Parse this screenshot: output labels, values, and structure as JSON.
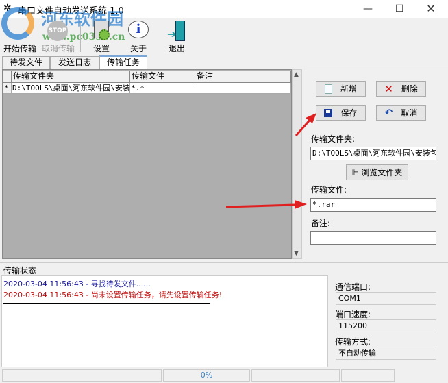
{
  "window": {
    "title": "串口文件自动发送系统 1.0",
    "controls": [
      "minimize",
      "maximize",
      "close"
    ]
  },
  "watermark": {
    "text": "河东软件园",
    "url": "www.pc0359.cn"
  },
  "toolbar": [
    {
      "label": "开始传输",
      "icon": "start-transfer-icon",
      "enabled": true
    },
    {
      "label": "取消传输",
      "icon": "stop-icon",
      "enabled": false
    },
    {
      "label": "设置",
      "icon": "settings-icon",
      "enabled": true
    },
    {
      "label": "关于",
      "icon": "info-icon",
      "enabled": true
    },
    {
      "label": "退出",
      "icon": "exit-door-icon",
      "enabled": true
    }
  ],
  "tabs": [
    {
      "label": "待发文件"
    },
    {
      "label": "发送日志"
    },
    {
      "label": "传输任务",
      "active": true
    }
  ],
  "grid": {
    "columns": [
      "传输文件夹",
      "传输文件",
      "备注"
    ],
    "rows": [
      {
        "indicator": "*",
        "folder": "D:\\TOOLS\\桌面\\河东软件园\\安装包",
        "file": "*.*",
        "note": ""
      }
    ]
  },
  "form": {
    "new_label": "新增",
    "delete_label": "删除",
    "save_label": "保存",
    "cancel_label": "取消",
    "folder_label": "传输文件夹:",
    "folder_value": "D:\\TOOLS\\桌面\\河东软件园\\安装包",
    "browse_label": "浏览文件夹",
    "file_label": "传输文件:",
    "file_value": "*.rar",
    "note_label": "备注:",
    "note_value": ""
  },
  "status": {
    "header": "传输状态",
    "log": [
      {
        "text": "2020-03-04 11:56:43 - 寻找待发文件......",
        "color": "#1a1aa0"
      },
      {
        "text": "2020-03-04 11:56:43 - 尚未设置传输任务，请先设置传输任务!",
        "color": "#c01010"
      }
    ],
    "port_label": "通信端口:",
    "port_value": "COM1",
    "speed_label": "端口速度:",
    "speed_value": "115200",
    "mode_label": "传输方式:",
    "mode_value": "不自动传输"
  },
  "statusbar": {
    "progress": "0%"
  }
}
